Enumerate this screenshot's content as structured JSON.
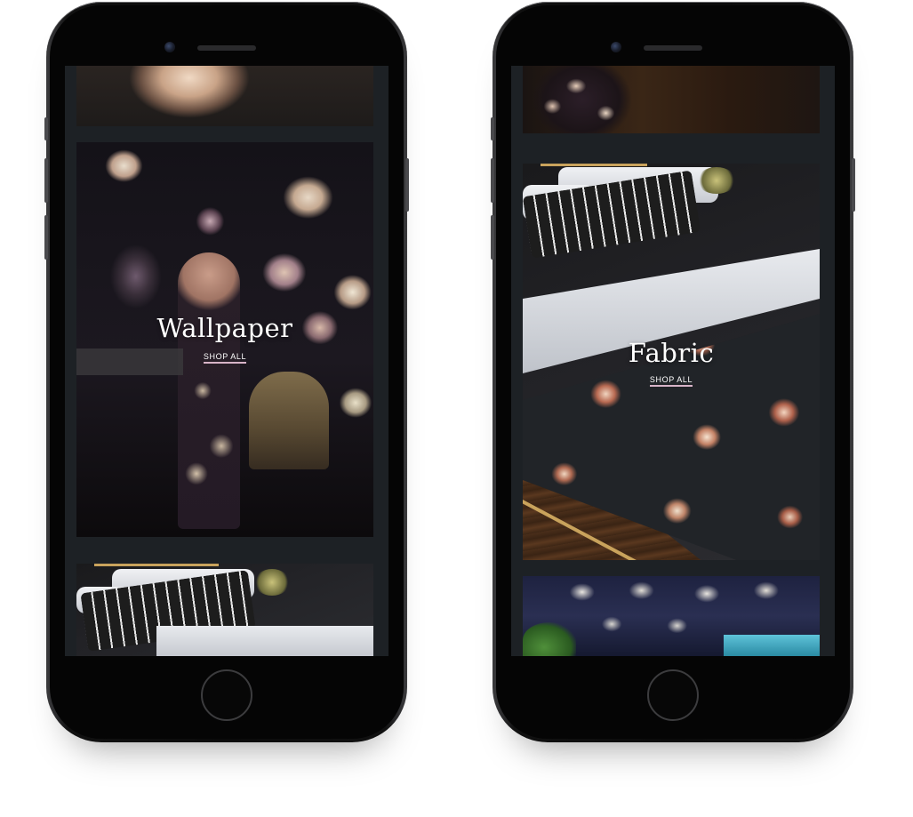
{
  "phones": [
    {
      "tiles": [
        {
          "kind": "floral-partial"
        },
        {
          "kind": "wallpaper",
          "title": "Wallpaper",
          "link": "SHOP ALL"
        },
        {
          "kind": "bed-partial"
        }
      ]
    },
    {
      "tiles": [
        {
          "kind": "dress-partial"
        },
        {
          "kind": "fabric",
          "title": "Fabric",
          "link": "SHOP ALL"
        },
        {
          "kind": "mirror-floral-partial"
        }
      ]
    }
  ],
  "colors": {
    "screen_background": "#1d2125",
    "link_underline": "#d8b4c8",
    "title_text": "#ffffff"
  }
}
